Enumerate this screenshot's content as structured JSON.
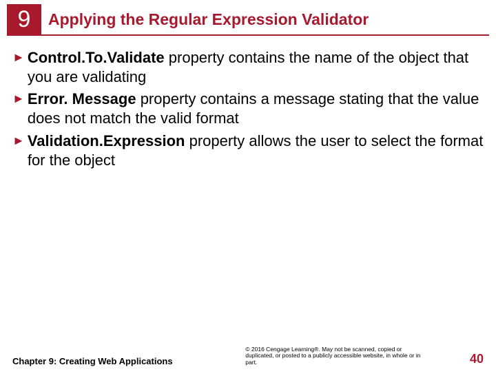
{
  "chapterNumber": "9",
  "slideTitle": "Applying the Regular Expression Validator",
  "bullets": [
    {
      "term": "Control.To.Validate",
      "rest": " property contains the name of the object that you are validating"
    },
    {
      "term": "Error. Message",
      "rest": " property contains a message stating that the value does not match the valid format"
    },
    {
      "term": "Validation.Expression",
      "rest": " property allows the user to select the format for the object"
    }
  ],
  "footer": {
    "chapterLabel": "Chapter 9: Creating Web Applications",
    "copyright": "© 2016 Cengage Learning®. May not be scanned, copied or duplicated, or posted to a publicly accessible website, in whole or in part.",
    "pageNumber": "40"
  }
}
